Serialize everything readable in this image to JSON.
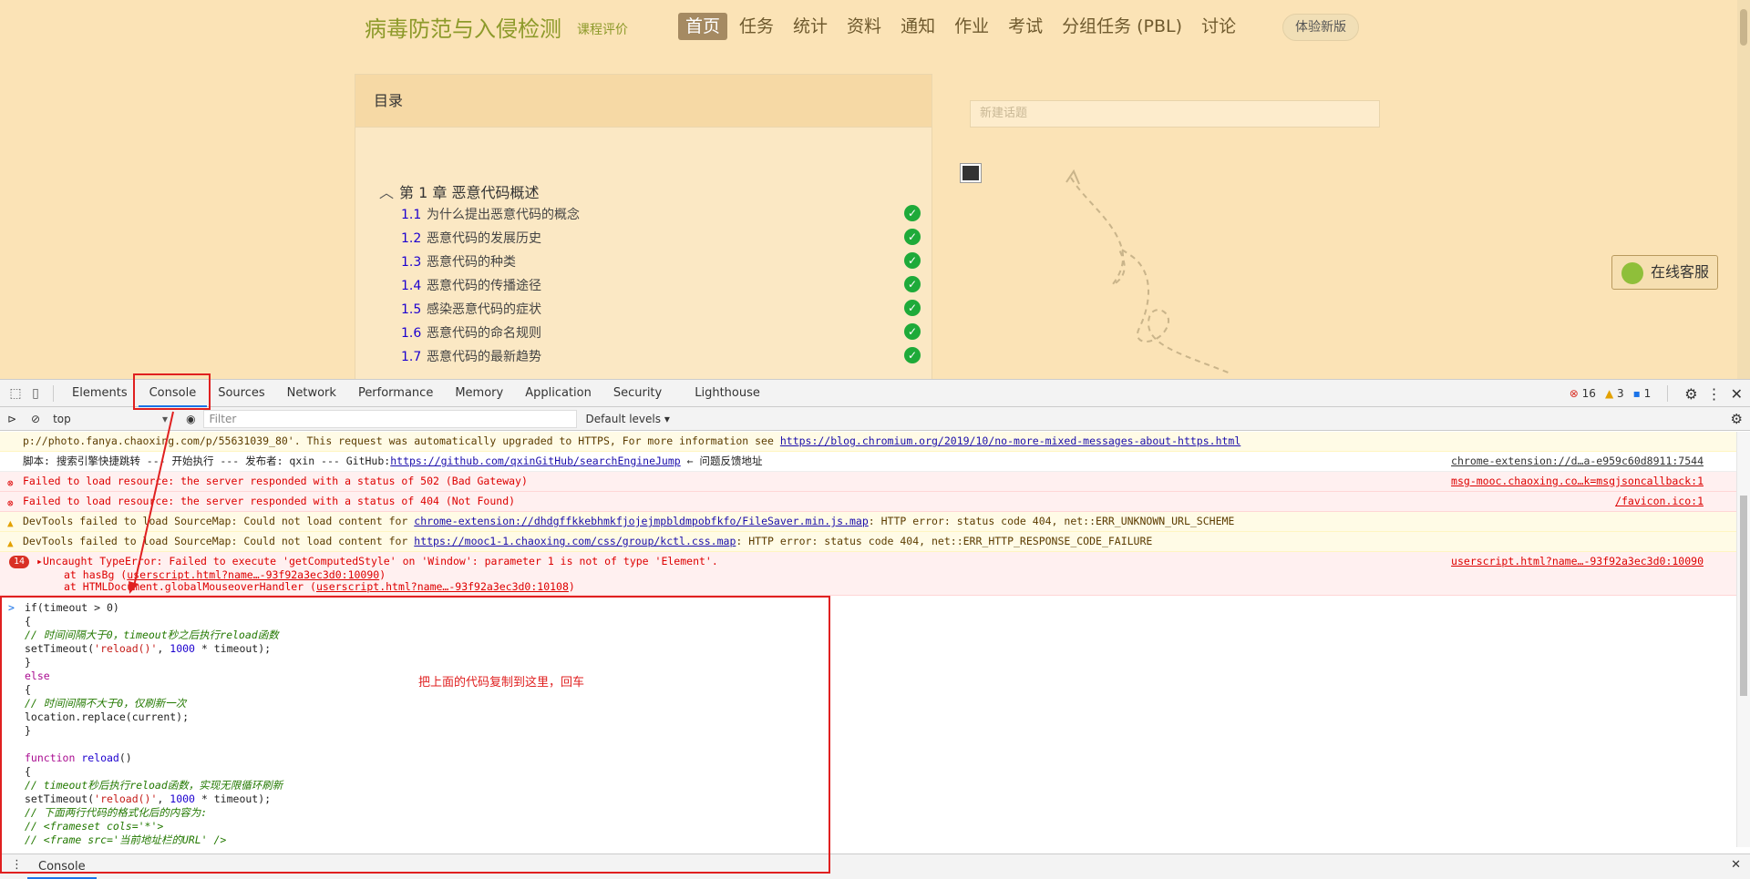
{
  "course": {
    "title": "病毒防范与入侵检测",
    "eval_link": "课程评价",
    "nav": [
      "首页",
      "任务",
      "统计",
      "资料",
      "通知",
      "作业",
      "考试",
      "分组任务 (PBL)",
      "讨论"
    ],
    "try_new": "体验新版"
  },
  "toc": {
    "header": "目录",
    "chapter_num": "第 1 章",
    "chapter_title": "恶意代码概述",
    "sections": [
      {
        "num": "1.1",
        "title": "为什么提出恶意代码的概念"
      },
      {
        "num": "1.2",
        "title": "恶意代码的发展历史"
      },
      {
        "num": "1.3",
        "title": "恶意代码的种类"
      },
      {
        "num": "1.4",
        "title": "恶意代码的传播途径"
      },
      {
        "num": "1.5",
        "title": "感染恶意代码的症状"
      },
      {
        "num": "1.6",
        "title": "恶意代码的命名规则"
      },
      {
        "num": "1.7",
        "title": "恶意代码的最新趋势"
      }
    ]
  },
  "discussion": {
    "placeholder": "新建话题"
  },
  "online_service": "在线客服",
  "devtools": {
    "tabs": [
      "Elements",
      "Console",
      "Sources",
      "Network",
      "Performance",
      "Memory",
      "Application",
      "Security",
      "Lighthouse"
    ],
    "active_tab": "Console",
    "counts": {
      "errors": "16",
      "warnings": "3",
      "info": "1"
    },
    "context": "top",
    "filter_placeholder": "Filter",
    "levels": "Default levels"
  },
  "messages": {
    "m0_pre": "p://photo.fanya.chaoxing.com/p/55631039_80'. This request was automatically upgraded to HTTPS, For more information see ",
    "m0_link": "https://blog.chromium.org/2019/10/no-more-mixed-messages-about-https.html",
    "m1_pre": "脚本: 搜索引擎快捷跳转 --- 开始执行 --- 发布者: qxin --- GitHub:",
    "m1_link": "https://github.com/qxinGitHub/searchEngineJump",
    "m1_post": " ← 问题反馈地址",
    "m1_src": "chrome-extension://d…a-e959c60d8911:7544",
    "m2_text": "Failed to load resource: the server responded with a status of 502 (Bad Gateway)",
    "m2_src": "msg-mooc.chaoxing.co…k=msgjsoncallback:1",
    "m3_text": "Failed to load resource: the server responded with a status of 404 (Not Found)",
    "m3_src": "/favicon.ico:1",
    "m4_pre": "DevTools failed to load SourceMap: Could not load content for ",
    "m4_link": "chrome-extension://dhdgffkkebhmkfjojejmpbldmpobfkfo/FileSaver.min.js.map",
    "m4_post": ": HTTP error: status code 404, net::ERR_UNKNOWN_URL_SCHEME",
    "m5_pre": "DevTools failed to load SourceMap: Could not load content for ",
    "m5_link": "https://mooc1-1.chaoxing.com/css/group/kctl.css.map",
    "m5_post": ": HTTP error: status code 404, net::ERR_HTTP_RESPONSE_CODE_FAILURE",
    "m6_badge": "14",
    "m6_text": "Uncaught TypeError: Failed to execute 'getComputedStyle' on 'Window': parameter 1 is not of type 'Element'.",
    "m6_src": "userscript.html?name…-93f92a3ec3d0:10090",
    "m6_stack1_pre": "at hasBg (",
    "m6_stack1_link": "userscript.html?name…-93f92a3ec3d0:10090",
    "m6_stack2_pre": "at HTMLDocument.globalMouseoverHandler (",
    "m6_stack2_link": "userscript.html?name…-93f92a3ec3d0:10108"
  },
  "code": {
    "l1": "if(timeout > 0)",
    "l2": "{",
    "l3": "// 时间间隔大于0，timeout秒之后执行reload函数",
    "l4_a": "setTimeout(",
    "l4_s": "'reload()'",
    "l4_b": ", ",
    "l4_n": "1000",
    "l4_c": " * timeout);",
    "l5": "}",
    "l6": "else",
    "l7": "{",
    "l8": "// 时间间隔不大于0，仅刷新一次",
    "l9": "location.replace(current);",
    "l10": "}",
    "l11": "",
    "l12_kw": "function",
    "l12_fn": " reload",
    "l12_rest": "()",
    "l13": "{",
    "l14": "// timeout秒后执行reload函数，实现无限循环刷新",
    "l15_a": "setTimeout(",
    "l15_s": "'reload()'",
    "l15_b": ", ",
    "l15_n": "1000",
    "l15_c": " * timeout);",
    "l16": "// 下面两行代码的格式化后的内容为:",
    "l17": "// <frameset cols='*'>",
    "l18": "// <frame src='当前地址栏的URL' />"
  },
  "annotation": "把上面的代码复制到这里，回车",
  "drawer_tab": "Console"
}
